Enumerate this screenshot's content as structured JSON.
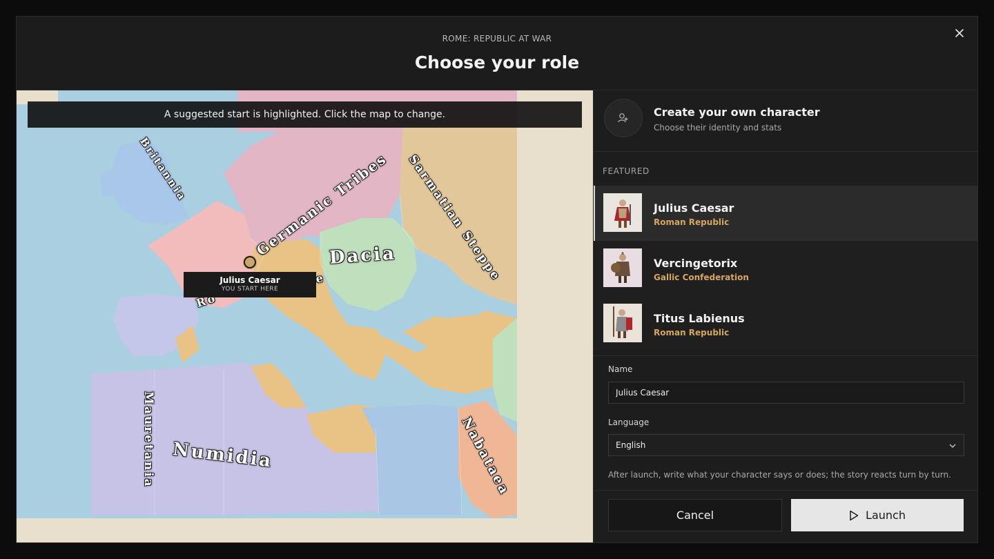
{
  "modal": {
    "kicker": "ROME: REPUBLIC AT WAR",
    "title": "Choose your role",
    "close_icon": "close-icon"
  },
  "map": {
    "banner": "A suggested start is highlighted. Click the map to change.",
    "regions": {
      "britannia": "Britannia",
      "germanic": "Germanic Tribes",
      "sarmatian": "Sarmatian Steppe",
      "dacia": "Dacia",
      "mauretania": "Mauretania",
      "numidia": "Numidia",
      "nabataea": "Nabataea",
      "rome_partial": "Ro",
      "partial_e": "e"
    },
    "marker": {
      "name": "Julius Caesar",
      "sub": "YOU START HERE"
    },
    "colors": {
      "sea": "#a9cfe0",
      "land": "#e8e0cc",
      "gaul": "#f2bcbd",
      "germania": "#e3b6c6",
      "sarmatia": "#e1c79a",
      "dacia": "#bfe0bd",
      "rome": "#e8c385",
      "iberia": "#c4c6ea",
      "africa": "#c7c3e6",
      "egypt": "#a9c6e5",
      "nabataea": "#f0b796",
      "britannia": "#a9c7e8"
    }
  },
  "panel": {
    "create": {
      "title": "Create your own character",
      "subtitle": "Choose their identity and stats",
      "icon": "add-user-icon"
    },
    "featured_label": "FEATURED",
    "characters": [
      {
        "name": "Julius Caesar",
        "faction": "Roman Republic",
        "selected": true
      },
      {
        "name": "Vercingetorix",
        "faction": "Gallic Confederation",
        "selected": false
      },
      {
        "name": "Titus Labienus",
        "faction": "Roman Republic",
        "selected": false
      }
    ],
    "name_label": "Name",
    "name_value": "Julius Caesar",
    "language_label": "Language",
    "language_value": "English",
    "help": "After launch, write what your character says or does; the story reacts turn by turn.",
    "cancel": "Cancel",
    "launch": "Launch",
    "accent": "#d6a65f"
  }
}
